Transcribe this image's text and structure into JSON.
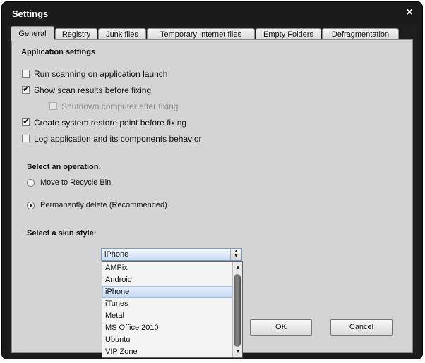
{
  "window": {
    "title": "Settings"
  },
  "tabs": [
    {
      "label": "General"
    },
    {
      "label": "Registry"
    },
    {
      "label": "Junk files"
    },
    {
      "label": "Temporary Internet files"
    },
    {
      "label": "Empty Folders"
    },
    {
      "label": "Defragmentation"
    }
  ],
  "app_settings": {
    "heading": "Application settings",
    "options": [
      {
        "label": "Run scanning on application launch",
        "checked": false,
        "enabled": true
      },
      {
        "label": "Show scan results before fixing",
        "checked": true,
        "enabled": true
      },
      {
        "label": "Shutdown computer after fixing",
        "checked": false,
        "enabled": false
      },
      {
        "label": "Create system restore point before fixing",
        "checked": true,
        "enabled": true
      },
      {
        "label": "Log application and its components behavior",
        "checked": false,
        "enabled": true
      }
    ]
  },
  "operation": {
    "heading": "Select an operation:",
    "options": [
      {
        "label": "Move to Recycle Bin",
        "selected": false
      },
      {
        "label": "Permanently delete (Recommended)",
        "selected": true
      }
    ]
  },
  "skin": {
    "heading": "Select a skin style:",
    "selected": "iPhone",
    "options": [
      "AMPix",
      "Android",
      "iPhone",
      "iTunes",
      "Metal",
      "MS Office 2010",
      "Ubuntu",
      "VIP Zone"
    ]
  },
  "buttons": {
    "ok": "OK",
    "cancel": "Cancel"
  },
  "icons": {
    "close": "×",
    "check": "✔",
    "arrow_up": "▲",
    "arrow_down": "▼"
  }
}
